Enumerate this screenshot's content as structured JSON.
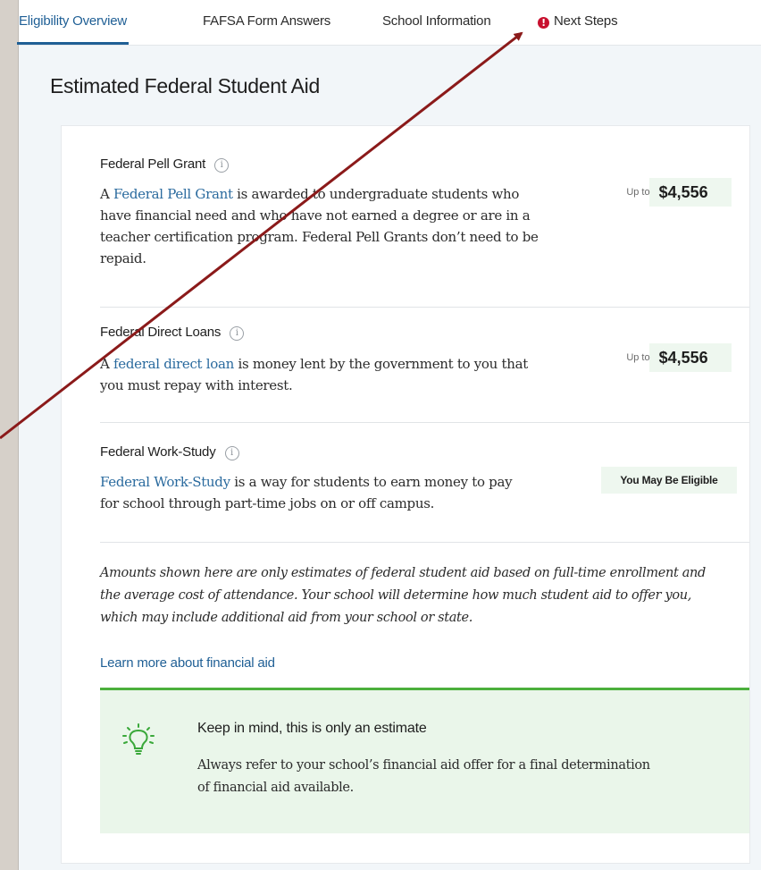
{
  "tabs": [
    {
      "label": "Eligibility Overview",
      "active": true
    },
    {
      "label": "FAFSA Form Answers",
      "active": false
    },
    {
      "label": "School Information",
      "active": false
    },
    {
      "label": "Next Steps",
      "active": false,
      "alert": "!"
    }
  ],
  "page": {
    "heading": "Estimated Federal Student Aid"
  },
  "aid": {
    "pell": {
      "title": "Federal Pell Grant",
      "info_icon": "i",
      "link": "Federal Pell Grant",
      "desc_prefix": "A ",
      "desc_rest": " is awarded to undergraduate students who have financial need and who have not earned a degree or are in a teacher certification program. Federal Pell Grants don’t need to be repaid.",
      "upto": "Up to",
      "amount": "$4,556"
    },
    "loans": {
      "title": "Federal Direct Loans",
      "info_icon": "i",
      "link": "federal direct loan",
      "desc_prefix": "A ",
      "desc_rest": " is money lent by the government to you that you must repay with interest.",
      "upto": "Up to",
      "amount": "$4,556"
    },
    "workstudy": {
      "title": "Federal Work-Study",
      "info_icon": "i",
      "link": "Federal Work-Study",
      "desc_rest": " is a way for students to earn money to pay for school through part-time jobs on or off campus.",
      "status": "You May Be Eligible"
    }
  },
  "disclaimer": "Amounts shown here are only estimates of federal student aid based on full-time enrollment and the average cost of attendance. Your school will determine how much student aid to offer you, which may include additional aid from your school or state.",
  "learn_more": "Learn more about financial aid",
  "callout": {
    "icon": "lightbulb-icon",
    "title": "Keep in mind, this is only an estimate",
    "body": "Always refer to your school’s financial aid offer for a final determination of financial aid available."
  },
  "colors": {
    "accent": "#1f5f95",
    "alert": "#c8102e",
    "callout_border": "#4caf3c",
    "callout_bg": "#eaf6ea",
    "annotation_arrow": "#8b1a1a"
  }
}
